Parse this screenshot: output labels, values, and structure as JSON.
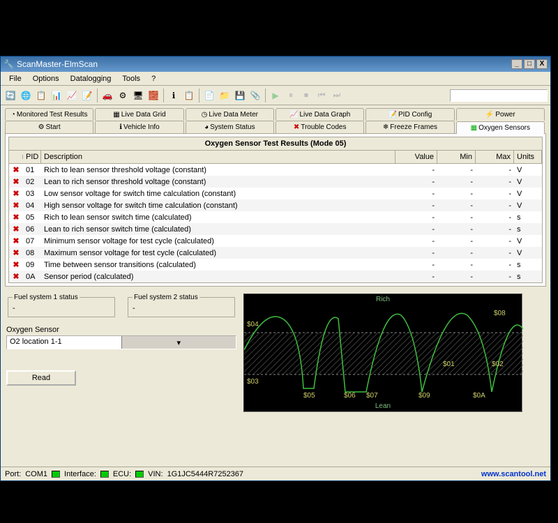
{
  "window": {
    "title": "ScanMaster-ElmScan"
  },
  "menu": {
    "items": [
      "File",
      "Options",
      "Datalogging",
      "Tools",
      "?"
    ]
  },
  "tabs_row1": [
    "Monitored Test Results",
    "Live Data Grid",
    "Live Data Meter",
    "Live Data Graph",
    "PID Config",
    "Power"
  ],
  "tabs_row2": [
    "Start",
    "Vehicle Info",
    "System Status",
    "Trouble Codes",
    "Freeze Frames",
    "Oxygen Sensors"
  ],
  "active_tab": "Oxygen Sensors",
  "grid": {
    "title": "Oxygen Sensor Test Results (Mode 05)",
    "headers": {
      "pid": "PID",
      "desc": "Description",
      "val": "Value",
      "min": "Min",
      "max": "Max",
      "units": "Units"
    },
    "rows": [
      {
        "pid": "01",
        "desc": "Rich to lean sensor threshold voltage (constant)",
        "val": "-",
        "min": "-",
        "max": "-",
        "units": "V"
      },
      {
        "pid": "02",
        "desc": "Lean to rich sensor threshold voltage (constant)",
        "val": "-",
        "min": "-",
        "max": "-",
        "units": "V"
      },
      {
        "pid": "03",
        "desc": "Low sensor voltage for switch time calculation (constant)",
        "val": "-",
        "min": "-",
        "max": "-",
        "units": "V"
      },
      {
        "pid": "04",
        "desc": "High sensor voltage for switch time calculation (constant)",
        "val": "-",
        "min": "-",
        "max": "-",
        "units": "V"
      },
      {
        "pid": "05",
        "desc": "Rich to lean sensor switch time (calculated)",
        "val": "-",
        "min": "-",
        "max": "-",
        "units": "s"
      },
      {
        "pid": "06",
        "desc": "Lean to rich sensor switch time (calculated)",
        "val": "-",
        "min": "-",
        "max": "-",
        "units": "s"
      },
      {
        "pid": "07",
        "desc": "Minimum sensor voltage for test cycle (calculated)",
        "val": "-",
        "min": "-",
        "max": "-",
        "units": "V"
      },
      {
        "pid": "08",
        "desc": "Maximum sensor voltage for test cycle (calculated)",
        "val": "-",
        "min": "-",
        "max": "-",
        "units": "V"
      },
      {
        "pid": "09",
        "desc": "Time between sensor transitions (calculated)",
        "val": "-",
        "min": "-",
        "max": "-",
        "units": "s"
      },
      {
        "pid": "0A",
        "desc": "Sensor period (calculated)",
        "val": "-",
        "min": "-",
        "max": "-",
        "units": "s"
      }
    ]
  },
  "lower": {
    "fs1": {
      "label": "Fuel system 1 status",
      "value": "-"
    },
    "fs2": {
      "label": "Fuel system 2 status",
      "value": "-"
    },
    "o2label": "Oxygen Sensor",
    "o2sel": "O2 location 1-1",
    "read": "Read"
  },
  "graph": {
    "rich": "Rich",
    "lean": "Lean",
    "labels": [
      "$01",
      "$02",
      "$03",
      "$04",
      "$05",
      "$06",
      "$07",
      "$08",
      "$09",
      "$0A"
    ]
  },
  "status": {
    "port_label": "Port:",
    "port": "COM1",
    "interface": "Interface:",
    "ecu": "ECU:",
    "vin_label": "VIN:",
    "vin": "1G1JC5444R7252367",
    "url": "www.scantool.net"
  }
}
